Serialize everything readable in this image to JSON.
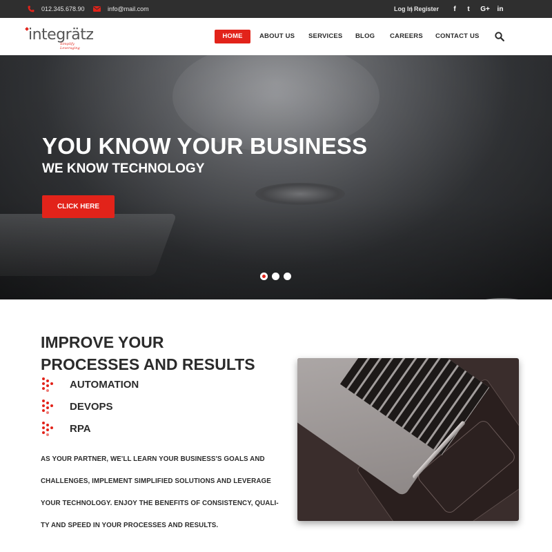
{
  "topbar": {
    "phone": "012.345.678.90",
    "email": "info@mail.com",
    "login": "Log In",
    "separator": "|",
    "register": "Register",
    "social": {
      "facebook": "f",
      "twitter": "t",
      "googleplus": "G+",
      "linkedin": "in"
    }
  },
  "brand": {
    "name": "integrätz",
    "tagline": "Simplify Leveraging",
    "accent": "#e2231a"
  },
  "nav": {
    "items": [
      {
        "label": "HOME",
        "active": true
      },
      {
        "label": "ABOUT US"
      },
      {
        "label": "SERVICES"
      },
      {
        "label": "BLOG"
      },
      {
        "label": "CAREERS"
      },
      {
        "label": "CONTACT US"
      }
    ],
    "search_icon": "search-icon"
  },
  "hero": {
    "title": "YOU KNOW YOUR BUSINESS",
    "subtitle": "WE KNOW TECHNOLOGY",
    "cta": "CLICK HERE",
    "slides_total": 3,
    "active_slide": 1
  },
  "section": {
    "title_line1": "IMPROVE YOUR",
    "title_line2": "PROCESSES AND RESULTS",
    "features": [
      "AUTOMATION",
      "DEVOPS",
      "RPA"
    ],
    "paragraph_lines": [
      " AS YOUR PARTNER, WE'LL LEARN YOUR BUSINESS'S GOALS AND",
      "CHALLENGES, IMPLEMENT SIMPLIFIED SOLUTIONS AND LEVERAGE",
      "YOUR TECHNOLOGY. ENJOY THE BENEFITS OF CONSISTENCY, QUALI-",
      "TY AND SPEED IN YOUR PROCESSES AND RESULTS."
    ]
  }
}
